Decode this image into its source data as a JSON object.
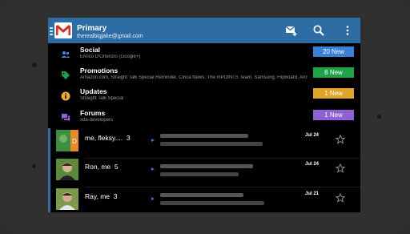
{
  "header": {
    "title": "Primary",
    "email": "therealbigjake@gmail.com",
    "icons": [
      "menu-icon",
      "gmail-logo",
      "compose-icon",
      "search-icon",
      "overflow-menu-icon"
    ],
    "color": "#2e6da4"
  },
  "categories": [
    {
      "name": "Social",
      "subtitle": "Enrico D'Ortenzio (Google+)",
      "badge": "20 New",
      "badge_color": "#3a7fd8",
      "icon": "people-icon",
      "icon_color": "#4a86e8"
    },
    {
      "name": "Promotions",
      "subtitle": "Amazon.com, Straight Talk Special Reminder, Cinca News, The mPOINTS Team, Samsung, Flipboard, Anne",
      "badge": "8 New",
      "badge_color": "#1fa34a",
      "icon": "tag-icon",
      "icon_color": "#1fa34a"
    },
    {
      "name": "Updates",
      "subtitle": "Straight Talk Special",
      "badge": "1 New",
      "badge_color": "#e0a526",
      "icon": "info-icon",
      "icon_color": "#f0a832"
    },
    {
      "name": "Forums",
      "subtitle": "xda-developers",
      "badge": "1 New",
      "badge_color": "#9160d3",
      "icon": "forum-icon",
      "icon_color": "#9160d3"
    }
  ],
  "messages": [
    {
      "sender": "me, fleksy....",
      "count": "3",
      "date": "Jul 24"
    },
    {
      "sender": "Ron, me",
      "count": "5",
      "date": "Jul 24"
    },
    {
      "sender": "Ray, me",
      "count": "3",
      "date": "Jul 21"
    }
  ]
}
